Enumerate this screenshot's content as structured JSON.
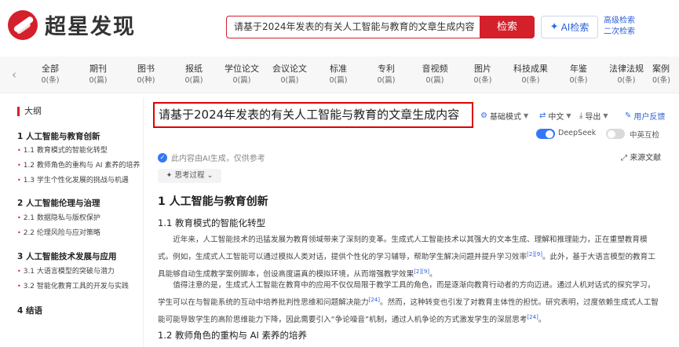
{
  "brand": {
    "name": "超星发现"
  },
  "search": {
    "query": "请基于2024年发表的有关人工智能与教育的文章生成内容",
    "button_label": "检索",
    "ai_label": "AI检索",
    "advanced": "高级检索",
    "secondary": "二次检索"
  },
  "categories": [
    {
      "name": "全部",
      "count": "0(条)"
    },
    {
      "name": "期刊",
      "count": "0(篇)"
    },
    {
      "name": "图书",
      "count": "0(种)"
    },
    {
      "name": "报纸",
      "count": "0(篇)"
    },
    {
      "name": "学位论文",
      "count": "0(篇)"
    },
    {
      "name": "会议论文",
      "count": "0(篇)"
    },
    {
      "name": "标准",
      "count": "0(篇)"
    },
    {
      "name": "专利",
      "count": "0(篇)"
    },
    {
      "name": "音视频",
      "count": "0(篇)"
    },
    {
      "name": "图片",
      "count": "0(条)"
    },
    {
      "name": "科技成果",
      "count": "0(条)"
    },
    {
      "name": "年鉴",
      "count": "0(条)"
    },
    {
      "name": "法律法规",
      "count": "0(条)"
    },
    {
      "name": "案例",
      "count": "0(条)"
    }
  ],
  "outline": {
    "title": "大纲",
    "sections": [
      {
        "heading": "1 人工智能与教育创新",
        "items": [
          "1.1 教育模式的智能化转型",
          "1.2 教师角色的重构与 AI 素养的培养",
          "1.3 学生个性化发展的挑战与机遇"
        ]
      },
      {
        "heading": "2 人工智能伦理与治理",
        "items": [
          "2.1 数据隐私与版权保护",
          "2.2 伦理风险与应对策略"
        ]
      },
      {
        "heading": "3 人工智能技术发展与应用",
        "items": [
          "3.1 大语言模型的突破与潜力",
          "3.2 智能化教育工具的开发与实践"
        ]
      },
      {
        "heading": "4 结语",
        "items": []
      }
    ]
  },
  "main": {
    "title": "请基于2024年发表的有关人工智能与教育的文章生成内容",
    "toolbar": {
      "mode": "基础模式",
      "language": "中文",
      "export": "导出",
      "feedback": "用户反馈"
    },
    "toggles": {
      "deepseek": "DeepSeek",
      "deepseek_on": true,
      "bilingual": "中英互检",
      "bilingual_on": false
    },
    "ai_note": "此内容由AI生成，仅供参考",
    "source_link": "来源文献",
    "think_label": "思考过程",
    "h1": "1 人工智能与教育创新",
    "h2_1": "1.1 教育模式的智能化转型",
    "p1": "近年来，人工智能技术的迅猛发展为教育领域带来了深刻的变革。生成式人工智能技术以其强大的文本生成、理解和推理能力，正在重塑教育模式。例如，生成式人工智能可以通过模拟人类对话，提供个性化的学习辅导，帮助学生解决问题并提升学习效率",
    "p1_ref1": "[2][9]",
    "p1_tail": "。此外，基于大语言模型的教育工具能够自动生成教学案例脚本，创设高度逼真的模拟环境，从而增强教学效果",
    "p1_ref2": "[2][9]",
    "p1_end": "。",
    "p2": "值得注意的是，生成式人工智能在教育中的应用不仅仅局限于教学工具的角色，而是逐渐向教育行动者的方向迈进。通过人机对话式的探究学习，学生可以在与智能系统的互动中培养批判性思维和问题解决能力",
    "p2_ref1": "[24]",
    "p2_tail": "。然而，这种转变也引发了对教育主体性的担忧。研究表明，过度依赖生成式人工智能可能导致学生的高阶思维能力下降，因此需要引入“争论噪音”机制，通过人机争论的方式激发学生的深层思考",
    "p2_ref2": "[24]",
    "p2_end": "。",
    "h2_2": "1.2 教师角色的重构与 AI 素养的培养"
  }
}
